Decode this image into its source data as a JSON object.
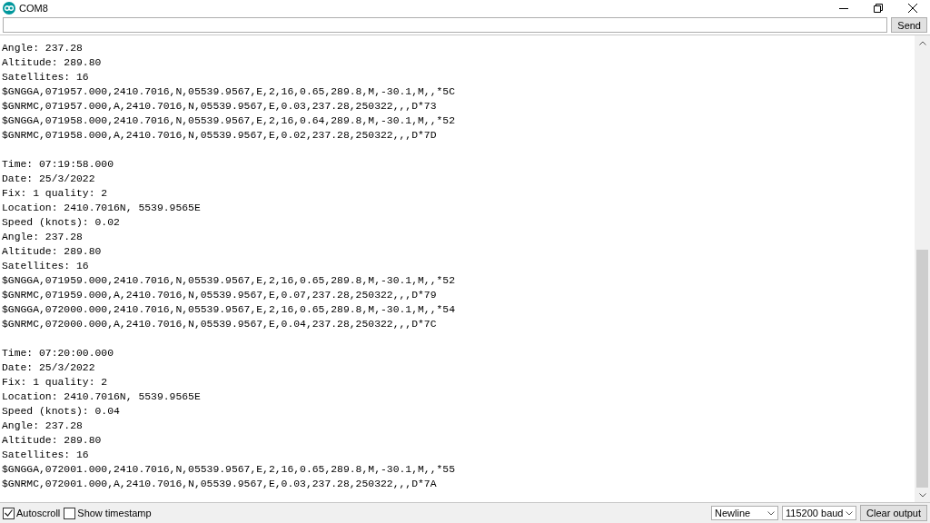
{
  "window": {
    "title": "COM8"
  },
  "send_button": "Send",
  "output_blocks": [
    [
      "Angle: 237.28",
      "Altitude: 289.80",
      "Satellites: 16",
      "$GNGGA,071957.000,2410.7016,N,05539.9567,E,2,16,0.65,289.8,M,-30.1,M,,*5C",
      "$GNRMC,071957.000,A,2410.7016,N,05539.9567,E,0.03,237.28,250322,,,D*73",
      "$GNGGA,071958.000,2410.7016,N,05539.9567,E,2,16,0.64,289.8,M,-30.1,M,,*52",
      "$GNRMC,071958.000,A,2410.7016,N,05539.9567,E,0.02,237.28,250322,,,D*7D"
    ],
    [
      "Time: 07:19:58.000",
      "Date: 25/3/2022",
      "Fix: 1 quality: 2",
      "Location: 2410.7016N, 5539.9565E",
      "Speed (knots): 0.02",
      "Angle: 237.28",
      "Altitude: 289.80",
      "Satellites: 16",
      "$GNGGA,071959.000,2410.7016,N,05539.9567,E,2,16,0.65,289.8,M,-30.1,M,,*52",
      "$GNRMC,071959.000,A,2410.7016,N,05539.9567,E,0.07,237.28,250322,,,D*79",
      "$GNGGA,072000.000,2410.7016,N,05539.9567,E,2,16,0.65,289.8,M,-30.1,M,,*54",
      "$GNRMC,072000.000,A,2410.7016,N,05539.9567,E,0.04,237.28,250322,,,D*7C"
    ],
    [
      "Time: 07:20:00.000",
      "Date: 25/3/2022",
      "Fix: 1 quality: 2",
      "Location: 2410.7016N, 5539.9565E",
      "Speed (knots): 0.04",
      "Angle: 237.28",
      "Altitude: 289.80",
      "Satellites: 16",
      "$GNGGA,072001.000,2410.7016,N,05539.9567,E,2,16,0.65,289.8,M,-30.1,M,,*55",
      "$GNRMC,072001.000,A,2410.7016,N,05539.9567,E,0.03,237.28,250322,,,D*7A"
    ]
  ],
  "options": [
    {
      "label": "Autoscroll",
      "checked": true
    },
    {
      "label": "Show timestamp",
      "checked": false
    }
  ],
  "line_ending": "Newline",
  "baud_rate": "115200 baud",
  "clear_button": "Clear output"
}
